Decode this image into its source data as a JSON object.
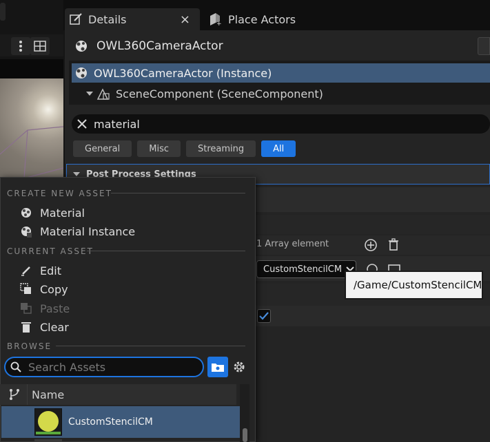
{
  "tabs": {
    "details_label": "Details",
    "close_glyph": "×",
    "place_actors_label": "Place Actors"
  },
  "actor": {
    "name": "OWL360CameraActor",
    "instance_label": "OWL360CameraActor (Instance)",
    "scene_component_label": "SceneComponent (SceneComponent)"
  },
  "search": {
    "value": "material"
  },
  "filters": [
    {
      "label": "General"
    },
    {
      "label": "Misc"
    },
    {
      "label": "Streaming"
    },
    {
      "label": "All",
      "active": true
    }
  ],
  "post_process": {
    "header": "Post Process Settings"
  },
  "array": {
    "count_text": "1 Array element"
  },
  "material_slot": {
    "selected": "CustomStencilCM",
    "tooltip": "/Game/CustomStencilCM"
  },
  "popup": {
    "create_header": "CREATE NEW ASSET",
    "create_items": [
      {
        "label": "Material",
        "icon": "material-sphere-icon"
      },
      {
        "label": "Material Instance",
        "icon": "material-instance-icon"
      }
    ],
    "current_header": "CURRENT ASSET",
    "current_items": [
      {
        "label": "Edit",
        "icon": "pencil-icon",
        "enabled": true
      },
      {
        "label": "Copy",
        "icon": "copy-icon",
        "enabled": true
      },
      {
        "label": "Paste",
        "icon": "paste-icon",
        "enabled": false
      },
      {
        "label": "Clear",
        "icon": "trash-icon",
        "enabled": true
      }
    ],
    "browse_header": "BROWSE",
    "search_placeholder": "Search Assets",
    "column_name": "Name",
    "asset_name": "CustomStencilCM"
  },
  "colors": {
    "accent": "#1d74e0",
    "selection": "#3e5a7b",
    "panel": "#242424"
  }
}
